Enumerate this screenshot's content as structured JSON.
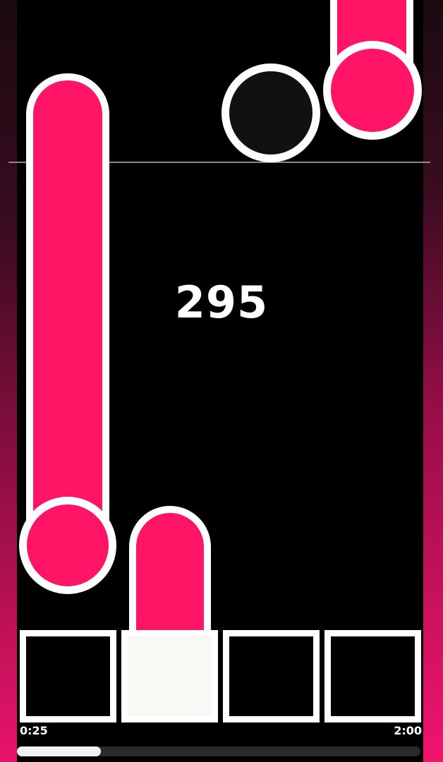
{
  "game": {
    "score": "295",
    "time_elapsed": "0:25",
    "time_total": "2:00",
    "progress_fraction": 0.208,
    "lanes": 4,
    "active_pad_index": 1
  },
  "colors": {
    "note_fill": "#ff1466",
    "note_border": "#ffffff",
    "background": "#000000",
    "side_gradient_bottom": "#f0146e",
    "pad_active": "#f8f8f4"
  },
  "icons": {
    "tap_note": "pink-circle",
    "hold_note": "pink-capsule",
    "dark_note": "black-circle"
  }
}
